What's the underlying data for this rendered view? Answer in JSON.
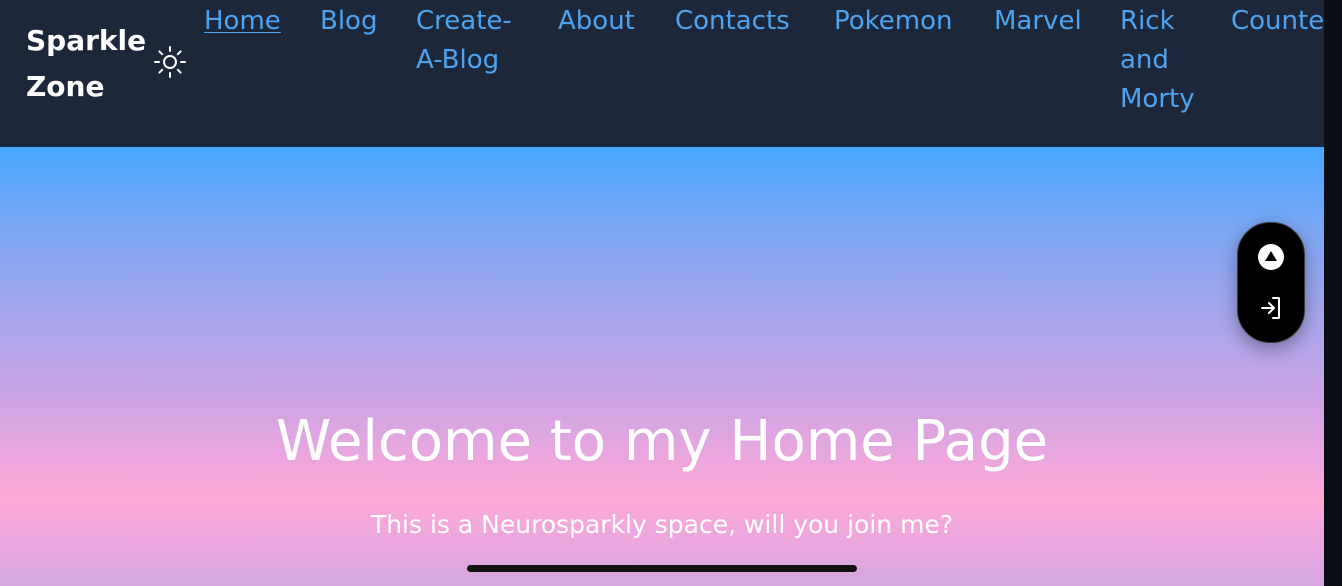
{
  "brand": {
    "name": "Sparkle Zone"
  },
  "theme_toggle": {
    "icon": "sun-icon"
  },
  "nav": {
    "items": [
      {
        "label": "Home",
        "active": true
      },
      {
        "label": "Blog"
      },
      {
        "label": "Create-A-Blog"
      },
      {
        "label": "About"
      },
      {
        "label": "Contacts"
      },
      {
        "label": "Pokemon"
      },
      {
        "label": "Marvel"
      },
      {
        "label": "Rick and Morty"
      },
      {
        "label": "Counter"
      }
    ]
  },
  "hero": {
    "title": "Welcome to my Home Page",
    "subtitle": "This is a Neurosparkly space, will you join me?"
  },
  "floating_panel": {
    "scroll_top_icon": "arrow-up-circle-icon",
    "login_icon": "sign-in-icon"
  },
  "colors": {
    "topbar": "#1c2739",
    "nav_link": "#4ea3ef",
    "gradient_top": "#46a7ff",
    "gradient_bottom": "#ffa8d8"
  }
}
